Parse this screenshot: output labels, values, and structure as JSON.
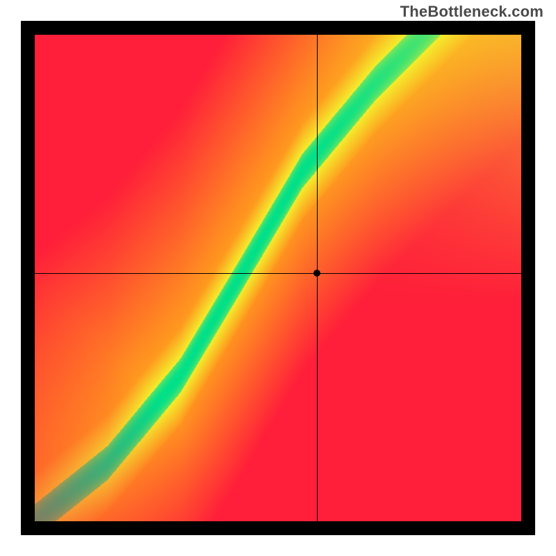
{
  "watermark": "TheBottleneck.com",
  "chart_data": {
    "type": "heatmap",
    "title": "",
    "xlabel": "",
    "ylabel": "",
    "xlim": [
      0,
      1
    ],
    "ylim": [
      0,
      1
    ],
    "colorscale": {
      "optimal": "#00e08a",
      "near": "#f5ee2d",
      "warn": "#ff9a1f",
      "bad": "#ff1f3a"
    },
    "crosshair": {
      "x": 0.58,
      "y": 0.51
    },
    "ridge": {
      "description": "Green optimal band roughly along y = f(x) with soft S-curve; yellow halo ~0.08 wide each side; fades through orange to red away from ridge. Top-right corner yellow plateau.",
      "control_points": [
        {
          "x": 0.0,
          "y": 0.0
        },
        {
          "x": 0.15,
          "y": 0.12
        },
        {
          "x": 0.3,
          "y": 0.3
        },
        {
          "x": 0.42,
          "y": 0.5
        },
        {
          "x": 0.55,
          "y": 0.72
        },
        {
          "x": 0.7,
          "y": 0.9
        },
        {
          "x": 0.8,
          "y": 1.0
        }
      ],
      "green_halfwidth": 0.035,
      "yellow_halfwidth": 0.1
    }
  }
}
